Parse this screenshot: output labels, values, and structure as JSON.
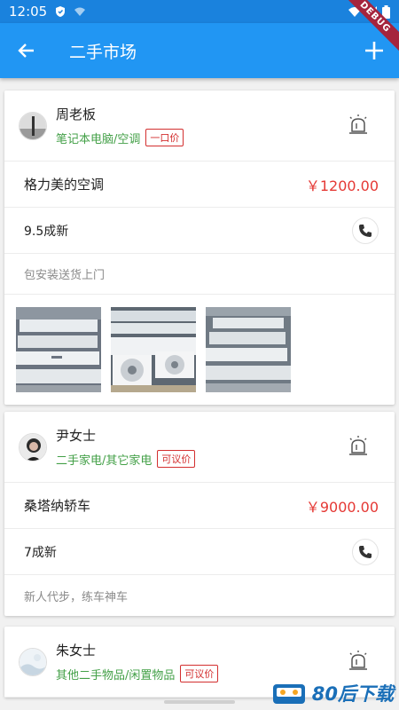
{
  "status_bar": {
    "time": "12:05"
  },
  "app_bar": {
    "title": "二手市场",
    "debug": "DEBUG"
  },
  "listings": [
    {
      "seller": "周老板",
      "category": "笔记本电脑/空调",
      "price_type": "一口价",
      "product": "格力美的空调",
      "price": "￥1200.00",
      "condition": "9.5成新",
      "description": "包安装送货上门",
      "photo_count": 3
    },
    {
      "seller": "尹女士",
      "category": "二手家电/其它家电",
      "price_type": "可议价",
      "product": "桑塔纳轿车",
      "price": "￥9000.00",
      "condition": "7成新",
      "description": "新人代步，练车神车"
    },
    {
      "seller": "朱女士",
      "category": "其他二手物品/闲置物品",
      "price_type": "可议价"
    }
  ],
  "watermark": {
    "text": "80后下载"
  },
  "colors": {
    "primary": "#2196f3",
    "price": "#e53935",
    "category": "#43a047",
    "badge": "#d32f2f"
  }
}
